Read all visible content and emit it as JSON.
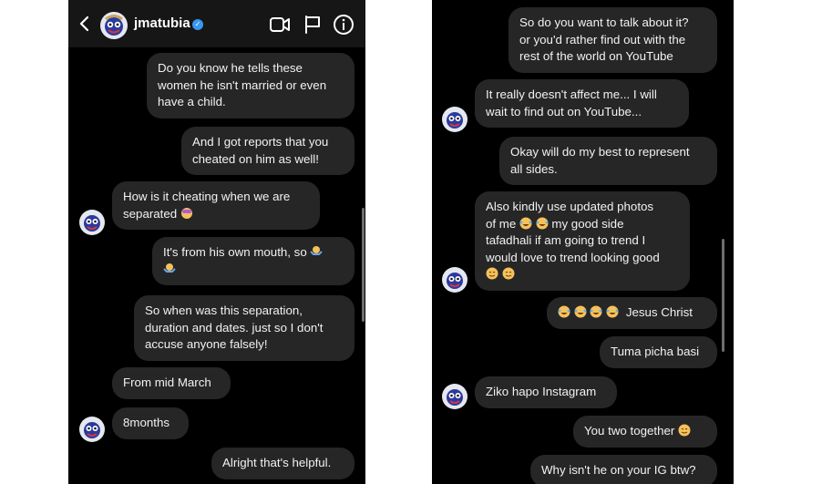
{
  "header": {
    "username": "jmatubia",
    "verified_glyph": "✓",
    "back_icon": "chevron-left-icon",
    "actions": [
      "video-call-icon",
      "report-flag-icon",
      "info-icon"
    ]
  },
  "left_messages": [
    {
      "id": "l1",
      "lines": [
        "Do you know he tells these",
        "women he isn't married or even",
        "have a child."
      ]
    },
    {
      "id": "l2",
      "lines": [
        "And I got reports that you",
        "cheated on him as well!"
      ]
    },
    {
      "id": "l3",
      "lines": [
        "How is it cheating when we are",
        "separated"
      ],
      "emoji": [
        "facepalm-emoji"
      ]
    },
    {
      "id": "l4",
      "lines": [
        "It's from his own mouth, so"
      ],
      "emoji": [
        "shrug-emoji",
        "shrug-emoji"
      ]
    },
    {
      "id": "l5",
      "lines": [
        "So when was this separation,",
        "duration and dates. just so I don't",
        "accuse anyone falsely!"
      ]
    },
    {
      "id": "l6",
      "lines": [
        "From mid March"
      ]
    },
    {
      "id": "l7",
      "lines": [
        "8months"
      ]
    },
    {
      "id": "l8",
      "lines": [
        "Alright that's helpful."
      ]
    }
  ],
  "right_messages": [
    {
      "id": "r1",
      "lines": [
        "So do you want to talk about it?",
        "or you'd rather find out with the",
        "rest of the world on YouTube"
      ]
    },
    {
      "id": "r2",
      "lines": [
        "It really doesn't affect me... I will",
        "wait to find out on YouTube..."
      ]
    },
    {
      "id": "r3",
      "lines": [
        "Okay will do my best to represent",
        "all sides."
      ]
    },
    {
      "id": "r4",
      "lines": [
        "Also kindly use updated photos",
        "of me",
        "my good side",
        "tafadhali if am going to trend I",
        "would love to trend looking good"
      ],
      "emoji": [
        "laughing-crying-emoji",
        "laughing-crying-emoji",
        "smiling-face-emoji",
        "smiling-face-emoji"
      ]
    },
    {
      "id": "r5",
      "lines": [
        "Jesus Christ"
      ],
      "emoji": [
        "laughing-crying-emoji",
        "laughing-crying-emoji",
        "laughing-crying-emoji",
        "laughing-crying-emoji"
      ]
    },
    {
      "id": "r6",
      "lines": [
        "Tuma picha basi"
      ]
    },
    {
      "id": "r7",
      "lines": [
        "Ziko hapo Instagram"
      ]
    },
    {
      "id": "r8",
      "lines": [
        "You two together"
      ],
      "emoji": [
        "smiling-face-emoji"
      ]
    },
    {
      "id": "r9",
      "lines": [
        "Why isn't he on your IG btw?"
      ]
    }
  ],
  "colors": {
    "background": "#000000",
    "header": "#161616",
    "bubble": "#262626",
    "text": "#f2f2f2",
    "verified": "#3897f0",
    "scrollbar": "#6e6e6e"
  }
}
